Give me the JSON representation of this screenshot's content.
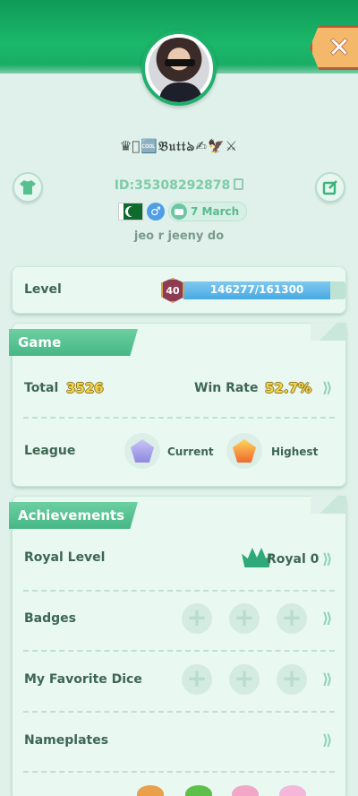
{
  "header": {
    "close_label": "✕",
    "nickname": "♛⃝🆒𝔅𝔲𝔱𝔱ঌ✍🦅⚔",
    "player_id": "ID:35308292878",
    "birthday": "7 March",
    "gender_symbol": "♂",
    "signature": "jeo r jeeny do"
  },
  "level": {
    "label": "Level",
    "value": "40",
    "xp_text": "146277/161300",
    "xp_fraction": 0.907
  },
  "game": {
    "section_title": "Game",
    "total_label": "Total",
    "total_value": "3526",
    "winrate_label": "Win Rate",
    "winrate_value": "52.7%",
    "league_label": "League",
    "current_label": "Current",
    "highest_label": "Highest"
  },
  "achievements": {
    "section_title": "Achievements",
    "royal_label": "Royal Level",
    "royal_value": "Royal 0",
    "badges_label": "Badges",
    "dice_label": "My Favorite Dice",
    "nameplates_label": "Nameplates",
    "plus_symbol": "+"
  },
  "icons": {
    "chevron": "⟫",
    "close": "close-icon",
    "shirt": "shirt-icon",
    "edit": "edit-icon",
    "copy": "copy-icon"
  },
  "colors": {
    "header_green": "#1bb86a",
    "accent_green": "#46b786",
    "xp_blue": "#48a9e2",
    "gold": "#f4d34a"
  }
}
